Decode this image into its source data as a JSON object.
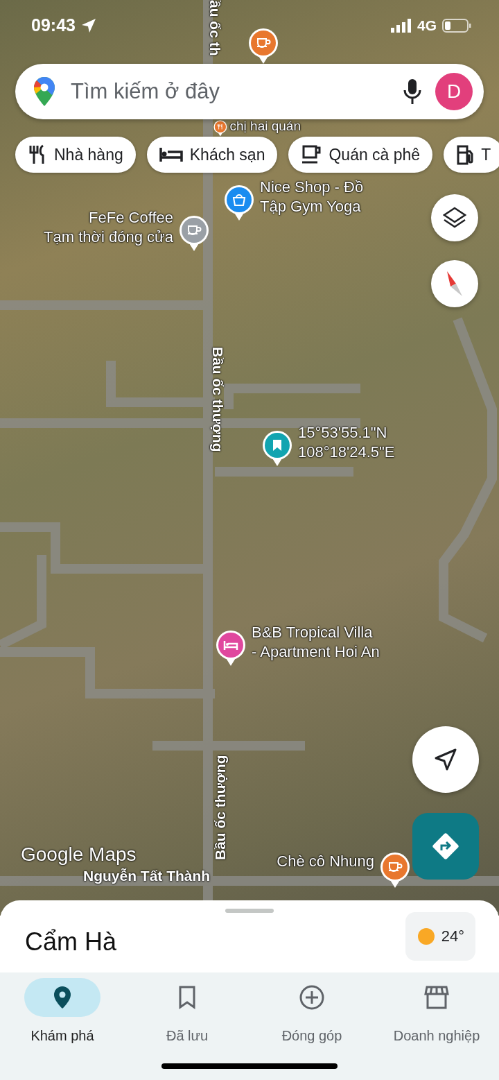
{
  "status_bar": {
    "time": "09:43",
    "network": "4G"
  },
  "search": {
    "placeholder": "Tìm kiếm ở đây",
    "avatar_letter": "D"
  },
  "chips": [
    {
      "kind": "restaurant",
      "label": "Nhà hàng"
    },
    {
      "kind": "hotel",
      "label": "Khách sạn"
    },
    {
      "kind": "cafe",
      "label": "Quán cà phê"
    },
    {
      "kind": "gas",
      "label": "T"
    }
  ],
  "map": {
    "pins": [
      {
        "kind": "cafe",
        "color": "#e8772e"
      },
      {
        "kind": "restaurant",
        "color": "#e8772e",
        "lines": [
          "chị hai quán"
        ]
      },
      {
        "kind": "shop",
        "color": "#1a8cf0",
        "lines": [
          "Nice Shop - Đồ",
          "Tập Gym Yoga"
        ]
      },
      {
        "kind": "cafe",
        "color": "#9aa0a6",
        "lines": [
          "FeFe Coffee",
          "Tạm thời đóng cửa"
        ]
      },
      {
        "kind": "saved",
        "color": "#12a4b0",
        "lines": [
          "15°53'55.1\"N",
          "108°18'24.5\"E"
        ]
      },
      {
        "kind": "hotel",
        "color": "#e0479e",
        "lines": [
          "B&B Tropical Villa",
          "- Apartment Hoi An"
        ]
      },
      {
        "kind": "cafe",
        "color": "#e8772e",
        "lines": [
          "Chè cô Nhung"
        ]
      }
    ],
    "streets": [
      "ầu ốc th",
      "Bầu ốc thượng",
      "Bầu ốc thượng",
      "Nguyễn Tất Thành"
    ],
    "logo": "Google Maps"
  },
  "sheet": {
    "title": "Cẩm Hà",
    "temperature": "24°"
  },
  "nav": [
    {
      "kind": "explore",
      "label": "Khám phá",
      "selected": true
    },
    {
      "kind": "saved",
      "label": "Đã lưu",
      "selected": false
    },
    {
      "kind": "contribute",
      "label": "Đóng góp",
      "selected": false
    },
    {
      "kind": "business",
      "label": "Doanh nghiệp",
      "selected": false
    }
  ]
}
